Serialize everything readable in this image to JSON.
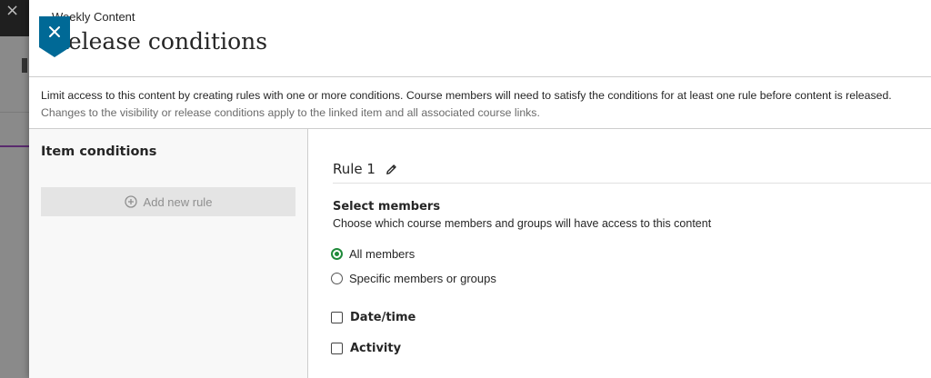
{
  "background": {
    "close_glyph": "×"
  },
  "panel": {
    "breadcrumb": "Weekly Content",
    "title": "Release conditions",
    "close_icon": "close-icon",
    "accent_color": "#006996"
  },
  "info": {
    "description": "Limit access to this content by creating rules with one or more conditions. Course members will need to satisfy the conditions for at least one rule before content is released.",
    "note": "Changes to the visibility or release conditions apply to the linked item and all associated course links."
  },
  "sidebar": {
    "title": "Item conditions",
    "add_rule_label": "Add new rule",
    "add_rule_icon": "plus-circle-icon"
  },
  "rule": {
    "title": "Rule 1",
    "edit_icon": "pencil-icon",
    "select_members": {
      "title": "Select members",
      "description": "Choose which course members and groups will have access to this content",
      "options": [
        {
          "label": "All members",
          "selected": true
        },
        {
          "label": "Specific members or groups",
          "selected": false
        }
      ],
      "selected_color": "#1f8a3a"
    },
    "conditions": [
      {
        "label": "Date/time",
        "checked": false
      },
      {
        "label": "Activity",
        "checked": false
      }
    ]
  }
}
